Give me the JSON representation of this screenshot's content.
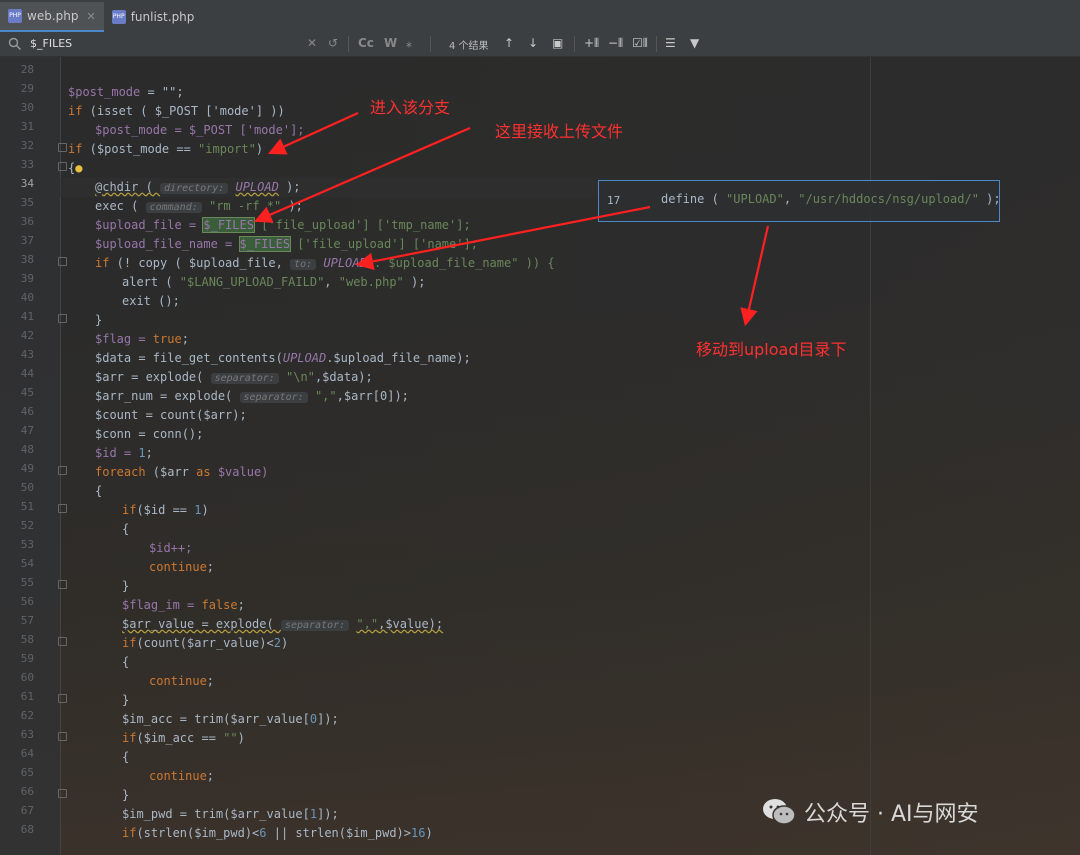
{
  "tabs": [
    {
      "label": "web.php",
      "icon": "php-file-icon",
      "active": true
    },
    {
      "label": "funlist.php",
      "icon": "php-file-icon",
      "active": false
    }
  ],
  "search": {
    "query": "$_FILES",
    "match_count": "4 个结果",
    "case_label": "Cc",
    "word_label": "W"
  },
  "popup": {
    "line_number": "17",
    "code_keyword": "define",
    "arg1": "\"UPLOAD\"",
    "arg2": "\"/usr/hddocs/nsg/upload/\""
  },
  "annotations": {
    "branch": "进入该分支",
    "receive": "这里接收上传文件",
    "move": "移动到upload目录下"
  },
  "watermark": "公众号 · AI与网安",
  "line_numbers": [
    "28",
    "29",
    "30",
    "31",
    "32",
    "33",
    "34",
    "35",
    "36",
    "37",
    "38",
    "39",
    "40",
    "41",
    "42",
    "43",
    "44",
    "45",
    "46",
    "47",
    "48",
    "49",
    "50",
    "51",
    "52",
    "53",
    "54",
    "55",
    "56",
    "57",
    "58",
    "59",
    "60",
    "61",
    "62",
    "63",
    "64",
    "65",
    "66",
    "67",
    "68"
  ],
  "code": {
    "l29_var": "$post_mode",
    "l29_rest": " = \"\";",
    "l30_kw": "if",
    "l30_rest": " (isset ( $_POST ['mode'] ))",
    "l31": "$post_mode = $_POST ['mode'];",
    "l32_kw": "if",
    "l32_a": " ($post_mode == ",
    "l32_str": "\"import\"",
    "l32_b": ")",
    "l33": "{",
    "l34_a": "@chdir ( ",
    "l34_hint": "directory:",
    "l34_const": "UPLOAD",
    "l34_b": " );",
    "l35_a": "exec ( ",
    "l35_hint": "command:",
    "l35_str": "\"rm -rf *\"",
    "l35_b": " );",
    "l36_a": "$upload_file = ",
    "l36_hl": "$_FILES",
    "l36_b": " ['file_upload'] ['tmp_name'];",
    "l37_a": "$upload_file_name = ",
    "l37_hl": "$_FILES",
    "l37_b": " ['file_upload'] ['name'];",
    "l38_kw": "if",
    "l38_a": " (! copy ( $upload_file, ",
    "l38_hint": "to:",
    "l38_const": "UPLOAD",
    "l38_b": " . $upload_file_name\" )) {",
    "l39_a": "alert ( ",
    "l39_str": "\"$LANG_UPLOAD_FAILD\"",
    "l39_b": ", ",
    "l39_str2": "\"web.php\"",
    "l39_c": " );",
    "l40": "exit ();",
    "l41": "}",
    "l42_a": "$flag = ",
    "l42_kw": "true",
    "l42_b": ";",
    "l43_a": "$data = file_get_contents(",
    "l43_const": "UPLOAD",
    "l43_b": ".$upload_file_name);",
    "l44_a": "$arr = explode( ",
    "l44_hint": "separator:",
    "l44_str": "\"\\n\"",
    "l44_b": ",$data);",
    "l45_a": "$arr_num = explode( ",
    "l45_hint": "separator:",
    "l45_str": "\",\"",
    "l45_b": ",$arr[0]);",
    "l46": "$count = count($arr);",
    "l47": "$conn = conn();",
    "l48_a": "$id = ",
    "l48_num": "1",
    "l48_b": ";",
    "l49_kw": "foreach",
    "l49_a": " ($arr ",
    "l49_kw2": "as",
    "l49_b": " $value)",
    "l50": "{",
    "l51_kw": "if",
    "l51_a": "($id == ",
    "l51_num": "1",
    "l51_b": ")",
    "l52": "{",
    "l53": "$id++;",
    "l54_kw": "continue",
    "l54_b": ";",
    "l55": "}",
    "l56_a": "$flag_im = ",
    "l56_kw": "false",
    "l56_b": ";",
    "l57_a": "$arr_value = explode( ",
    "l57_hint": "separator:",
    "l57_str": "\",\"",
    "l57_b": ",$value);",
    "l58_kw": "if",
    "l58_a": "(count($arr_value)<",
    "l58_num": "2",
    "l58_b": ")",
    "l59": "{",
    "l60_kw": "continue",
    "l60_b": ";",
    "l61": "}",
    "l62_a": "$im_acc = trim($arr_value[",
    "l62_num": "0",
    "l62_b": "]);",
    "l63_kw": "if",
    "l63_a": "($im_acc == ",
    "l63_str": "\"\"",
    "l63_b": ")",
    "l64": "{",
    "l65_kw": "continue",
    "l65_b": ";",
    "l66": "}",
    "l67_a": "$im_pwd = trim($arr_value[",
    "l67_num": "1",
    "l67_b": "]);",
    "l68_kw": "if",
    "l68_a": "(strlen($im_pwd)<",
    "l68_num": "6",
    "l68_b": " || strlen($im_pwd)>",
    "l68_num2": "16",
    "l68_c": ")"
  },
  "colors": {
    "keyword": "#cc7832",
    "variable": "#9876aa",
    "string": "#6a8759",
    "annotation": "#ff3030",
    "accent": "#4a88c7"
  }
}
